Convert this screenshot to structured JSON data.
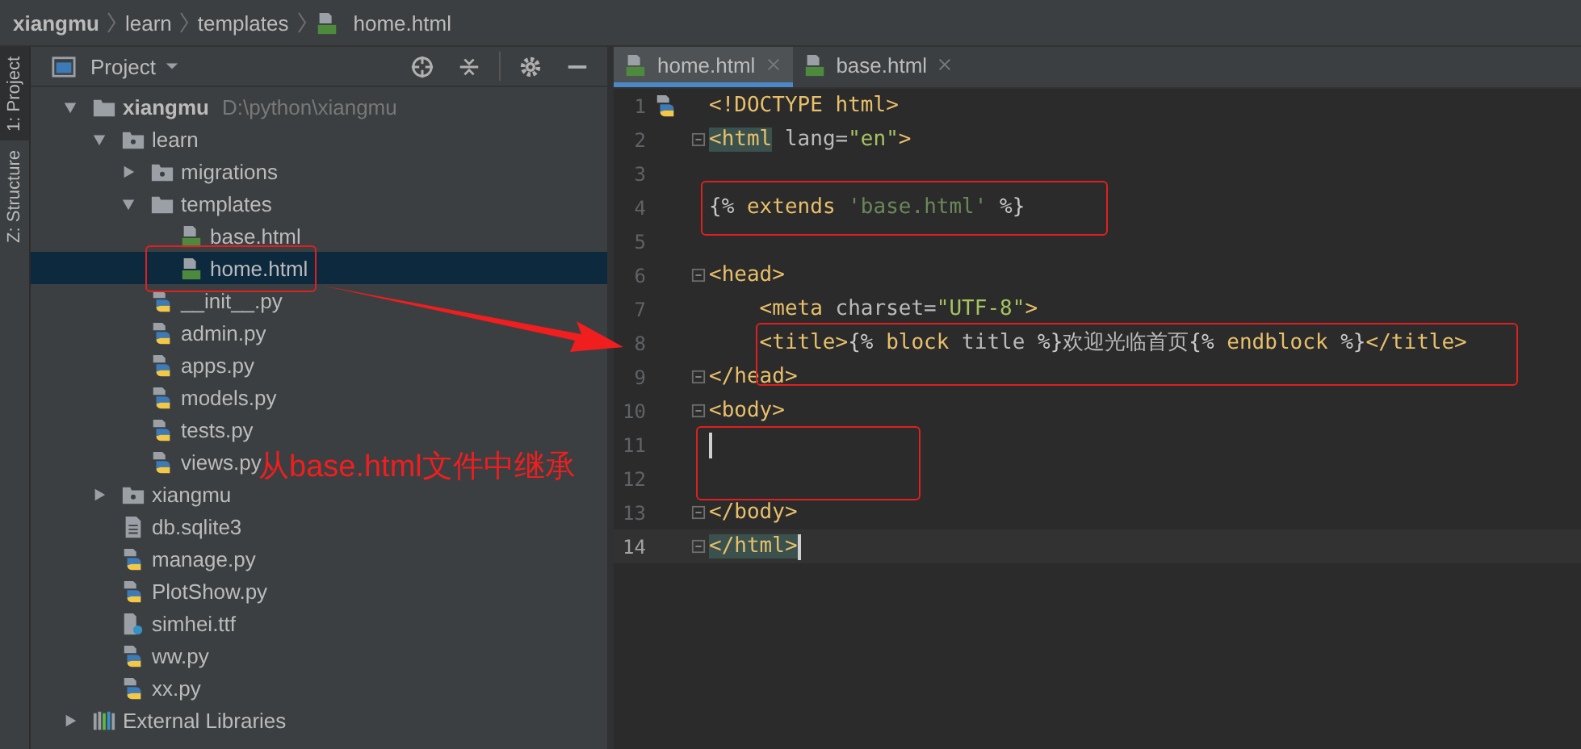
{
  "breadcrumb": [
    {
      "label": "xiangmu",
      "kind": "project"
    },
    {
      "label": "learn",
      "kind": "folder"
    },
    {
      "label": "templates",
      "kind": "folder"
    },
    {
      "label": "home.html",
      "kind": "html"
    }
  ],
  "side_tabs": [
    {
      "label": "1: Project",
      "selected": true
    },
    {
      "label": "Z: Structure",
      "selected": false
    }
  ],
  "project_panel": {
    "title": "Project",
    "tree": [
      {
        "label": "xiangmu",
        "kind": "root",
        "path": "D:\\python\\xiangmu",
        "expanded": true,
        "selected": false,
        "children": [
          {
            "label": "learn",
            "kind": "module",
            "expanded": true,
            "selected": false,
            "children": [
              {
                "label": "migrations",
                "kind": "module",
                "expanded": false,
                "selected": false
              },
              {
                "label": "templates",
                "kind": "folder",
                "expanded": true,
                "selected": false,
                "children": [
                  {
                    "label": "base.html",
                    "kind": "html",
                    "selected": false
                  },
                  {
                    "label": "home.html",
                    "kind": "html",
                    "selected": true
                  }
                ]
              },
              {
                "label": "__init__.py",
                "kind": "python",
                "selected": false
              },
              {
                "label": "admin.py",
                "kind": "python",
                "selected": false
              },
              {
                "label": "apps.py",
                "kind": "python",
                "selected": false
              },
              {
                "label": "models.py",
                "kind": "python",
                "selected": false
              },
              {
                "label": "tests.py",
                "kind": "python",
                "selected": false
              },
              {
                "label": "views.py",
                "kind": "python",
                "selected": false
              }
            ]
          },
          {
            "label": "xiangmu",
            "kind": "module",
            "expanded": false,
            "selected": false
          },
          {
            "label": "db.sqlite3",
            "kind": "text",
            "selected": false
          },
          {
            "label": "manage.py",
            "kind": "python",
            "selected": false
          },
          {
            "label": "PlotShow.py",
            "kind": "python",
            "selected": false
          },
          {
            "label": "simhei.ttf",
            "kind": "unknown",
            "selected": false
          },
          {
            "label": "ww.py",
            "kind": "python",
            "selected": false
          },
          {
            "label": "xx.py",
            "kind": "python",
            "selected": false
          }
        ]
      },
      {
        "label": "External Libraries",
        "kind": "library",
        "expanded": false,
        "selected": false
      }
    ]
  },
  "editor_tabs": [
    {
      "label": "home.html",
      "selected": true
    },
    {
      "label": "base.html",
      "selected": false
    }
  ],
  "code_lines": [
    {
      "number": "1",
      "current": false,
      "fold": false,
      "caret": false,
      "segments": [
        {
          "text": "<!DOCTYPE html>",
          "kind": "tag"
        }
      ]
    },
    {
      "number": "2",
      "current": false,
      "fold": true,
      "caret": false,
      "segments": [
        {
          "text": "<html",
          "kind": "tag",
          "matched": true
        },
        {
          "text": " lang=",
          "kind": "attr"
        },
        {
          "text": "\"en\"",
          "kind": "value"
        },
        {
          "text": ">",
          "kind": "tag"
        }
      ]
    },
    {
      "number": "3",
      "current": false,
      "fold": false,
      "caret": false
    },
    {
      "number": "4",
      "current": false,
      "fold": false,
      "caret": false,
      "segments": [
        {
          "text": "{%",
          "kind": "tpl"
        },
        {
          "text": " extends ",
          "kind": "keyword"
        },
        {
          "text": "'base.html'",
          "kind": "string"
        },
        {
          "text": " %}",
          "kind": "tpl"
        }
      ]
    },
    {
      "number": "5",
      "current": false,
      "fold": false,
      "caret": false
    },
    {
      "number": "6",
      "current": false,
      "fold": true,
      "caret": false,
      "segments": [
        {
          "text": "<head>",
          "kind": "tag"
        }
      ]
    },
    {
      "number": "7",
      "current": false,
      "fold": false,
      "caret": false,
      "indented": true,
      "segments": [
        {
          "text": "<meta",
          "kind": "tag"
        },
        {
          "text": " charset=",
          "kind": "attr"
        },
        {
          "text": "\"UTF-8\"",
          "kind": "value"
        },
        {
          "text": ">",
          "kind": "tag"
        }
      ]
    },
    {
      "number": "8",
      "current": false,
      "fold": false,
      "caret": false,
      "indented": true,
      "segments": [
        {
          "text": "<title>",
          "kind": "tag"
        },
        {
          "text": "{%",
          "kind": "tpl"
        },
        {
          "text": " block ",
          "kind": "keyword"
        },
        {
          "text": "title",
          "kind": "attr"
        },
        {
          "text": " %}",
          "kind": "tpl"
        },
        {
          "text": "欢迎光临首页",
          "kind": "attr"
        },
        {
          "text": "{%",
          "kind": "tpl"
        },
        {
          "text": " endblock ",
          "kind": "keyword"
        },
        {
          "text": "%}",
          "kind": "tpl"
        },
        {
          "text": "</title>",
          "kind": "tag"
        }
      ]
    },
    {
      "number": "9",
      "current": false,
      "fold": true,
      "caret": false,
      "segments": [
        {
          "text": "</head>",
          "kind": "tag"
        }
      ]
    },
    {
      "number": "10",
      "current": false,
      "fold": true,
      "caret": false,
      "segments": [
        {
          "text": "<body>",
          "kind": "tag"
        }
      ]
    },
    {
      "number": "11",
      "current": false,
      "fold": false,
      "caret": true
    },
    {
      "number": "12",
      "current": false,
      "fold": false,
      "caret": false
    },
    {
      "number": "13",
      "current": false,
      "fold": true,
      "caret": false,
      "segments": [
        {
          "text": "</body>",
          "kind": "tag"
        }
      ]
    },
    {
      "number": "14",
      "current": true,
      "fold": true,
      "caret": true,
      "segments": [
        {
          "text": "</html>",
          "kind": "tag",
          "matched": true
        }
      ]
    }
  ],
  "annotation": {
    "text": "从base.html文件中继承"
  }
}
